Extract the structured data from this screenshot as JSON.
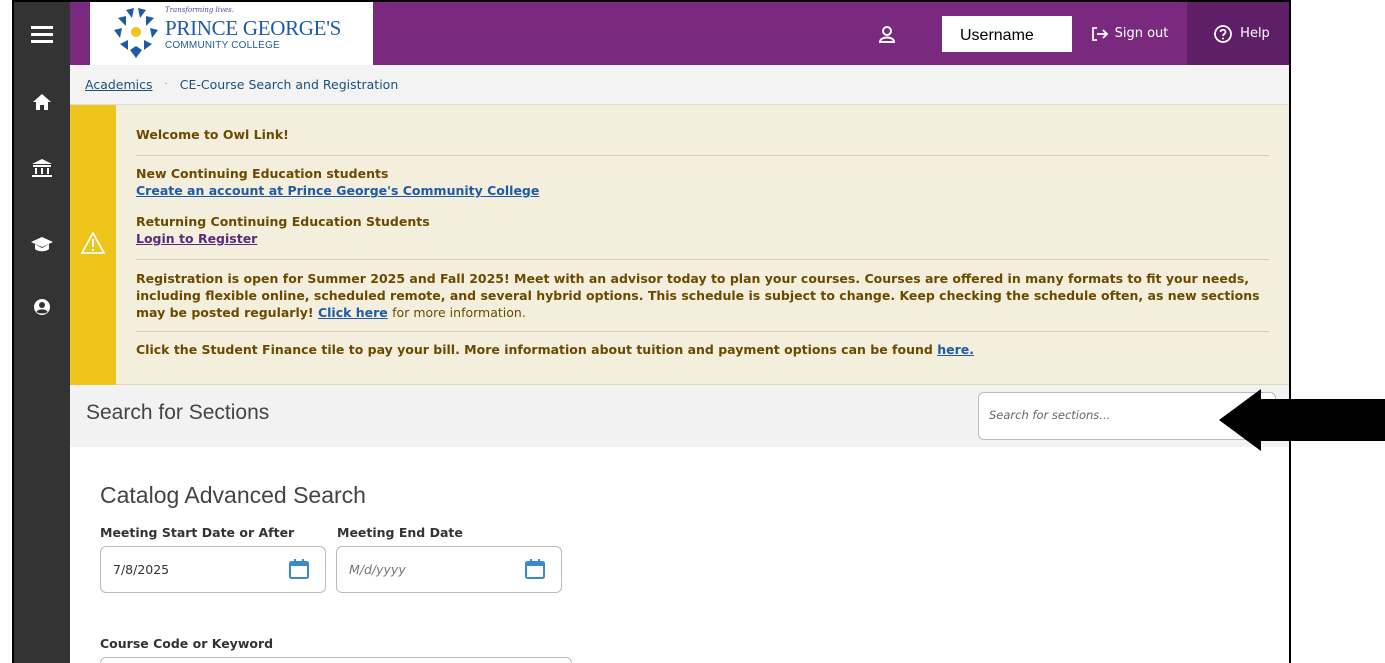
{
  "sidebar": {
    "items": [
      {
        "icon": "menu-icon"
      },
      {
        "icon": "home-icon"
      },
      {
        "icon": "academics-icon"
      },
      {
        "icon": "graduation-cap-icon"
      },
      {
        "icon": "user-circle-icon"
      }
    ]
  },
  "header": {
    "logo": {
      "tagline": "Transforming lives.",
      "name": "PRINCE GEORGE'S",
      "sub": "COMMUNITY COLLEGE"
    },
    "username": "Username",
    "sign_out": "Sign out",
    "help": "Help"
  },
  "breadcrumb": {
    "parent": "Academics",
    "separator": "·",
    "current": "CE-Course Search and Registration"
  },
  "alert": {
    "welcome": "Welcome to Owl Link!",
    "new_students_title": "New Continuing Education students",
    "new_students_link": "Create an account at Prince George's Community College",
    "returning_title": "Returning Continuing Education Students",
    "returning_link": "Login to Register",
    "registration_text": "Registration is open for Summer 2025 and Fall 2025! Meet with an advisor today to plan your courses. Courses are offered in many formats to fit your needs, including flexible online, scheduled remote, and several hybrid options. This schedule is subject to change. Keep checking the schedule often, as new sections may be posted regularly!",
    "click_here": "Click here",
    "more_info": "for more information.",
    "finance_text": "Click the Student Finance tile to pay your bill. More information about tuition and payment options can be found",
    "finance_link": "here."
  },
  "search": {
    "title": "Search for Sections",
    "placeholder": "Search for sections..."
  },
  "advanced": {
    "title": "Catalog Advanced Search",
    "start_label": "Meeting Start Date or After",
    "start_value": "7/8/2025",
    "end_label": "Meeting End Date",
    "end_placeholder": "M/d/yyyy",
    "course_label": "Course Code or Keyword"
  },
  "colors": {
    "header": "#792a7f",
    "sidebar": "#333333",
    "alert_bar": "#efc41b",
    "alert_bg": "#f4eedc"
  }
}
